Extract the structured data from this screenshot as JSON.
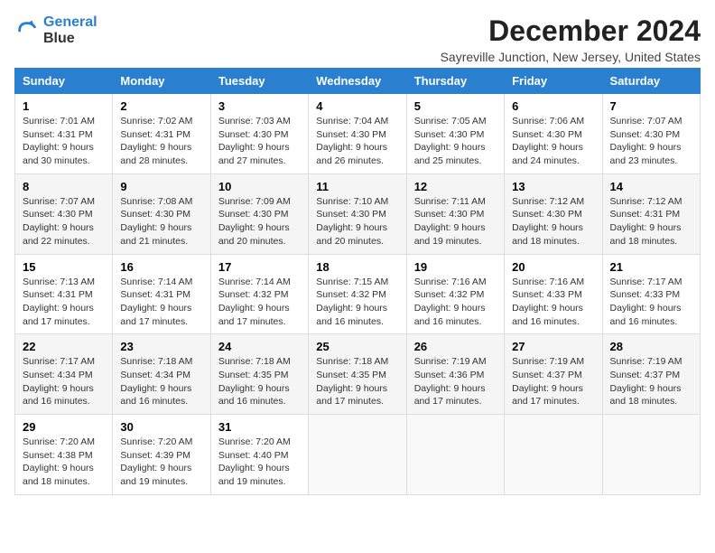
{
  "logo": {
    "name_part1": "General",
    "name_part2": "Blue"
  },
  "title": "December 2024",
  "subtitle": "Sayreville Junction, New Jersey, United States",
  "weekdays": [
    "Sunday",
    "Monday",
    "Tuesday",
    "Wednesday",
    "Thursday",
    "Friday",
    "Saturday"
  ],
  "weeks": [
    [
      {
        "day": "1",
        "info": "Sunrise: 7:01 AM\nSunset: 4:31 PM\nDaylight: 9 hours\nand 30 minutes."
      },
      {
        "day": "2",
        "info": "Sunrise: 7:02 AM\nSunset: 4:31 PM\nDaylight: 9 hours\nand 28 minutes."
      },
      {
        "day": "3",
        "info": "Sunrise: 7:03 AM\nSunset: 4:30 PM\nDaylight: 9 hours\nand 27 minutes."
      },
      {
        "day": "4",
        "info": "Sunrise: 7:04 AM\nSunset: 4:30 PM\nDaylight: 9 hours\nand 26 minutes."
      },
      {
        "day": "5",
        "info": "Sunrise: 7:05 AM\nSunset: 4:30 PM\nDaylight: 9 hours\nand 25 minutes."
      },
      {
        "day": "6",
        "info": "Sunrise: 7:06 AM\nSunset: 4:30 PM\nDaylight: 9 hours\nand 24 minutes."
      },
      {
        "day": "7",
        "info": "Sunrise: 7:07 AM\nSunset: 4:30 PM\nDaylight: 9 hours\nand 23 minutes."
      }
    ],
    [
      {
        "day": "8",
        "info": "Sunrise: 7:07 AM\nSunset: 4:30 PM\nDaylight: 9 hours\nand 22 minutes."
      },
      {
        "day": "9",
        "info": "Sunrise: 7:08 AM\nSunset: 4:30 PM\nDaylight: 9 hours\nand 21 minutes."
      },
      {
        "day": "10",
        "info": "Sunrise: 7:09 AM\nSunset: 4:30 PM\nDaylight: 9 hours\nand 20 minutes."
      },
      {
        "day": "11",
        "info": "Sunrise: 7:10 AM\nSunset: 4:30 PM\nDaylight: 9 hours\nand 20 minutes."
      },
      {
        "day": "12",
        "info": "Sunrise: 7:11 AM\nSunset: 4:30 PM\nDaylight: 9 hours\nand 19 minutes."
      },
      {
        "day": "13",
        "info": "Sunrise: 7:12 AM\nSunset: 4:30 PM\nDaylight: 9 hours\nand 18 minutes."
      },
      {
        "day": "14",
        "info": "Sunrise: 7:12 AM\nSunset: 4:31 PM\nDaylight: 9 hours\nand 18 minutes."
      }
    ],
    [
      {
        "day": "15",
        "info": "Sunrise: 7:13 AM\nSunset: 4:31 PM\nDaylight: 9 hours\nand 17 minutes."
      },
      {
        "day": "16",
        "info": "Sunrise: 7:14 AM\nSunset: 4:31 PM\nDaylight: 9 hours\nand 17 minutes."
      },
      {
        "day": "17",
        "info": "Sunrise: 7:14 AM\nSunset: 4:32 PM\nDaylight: 9 hours\nand 17 minutes."
      },
      {
        "day": "18",
        "info": "Sunrise: 7:15 AM\nSunset: 4:32 PM\nDaylight: 9 hours\nand 16 minutes."
      },
      {
        "day": "19",
        "info": "Sunrise: 7:16 AM\nSunset: 4:32 PM\nDaylight: 9 hours\nand 16 minutes."
      },
      {
        "day": "20",
        "info": "Sunrise: 7:16 AM\nSunset: 4:33 PM\nDaylight: 9 hours\nand 16 minutes."
      },
      {
        "day": "21",
        "info": "Sunrise: 7:17 AM\nSunset: 4:33 PM\nDaylight: 9 hours\nand 16 minutes."
      }
    ],
    [
      {
        "day": "22",
        "info": "Sunrise: 7:17 AM\nSunset: 4:34 PM\nDaylight: 9 hours\nand 16 minutes."
      },
      {
        "day": "23",
        "info": "Sunrise: 7:18 AM\nSunset: 4:34 PM\nDaylight: 9 hours\nand 16 minutes."
      },
      {
        "day": "24",
        "info": "Sunrise: 7:18 AM\nSunset: 4:35 PM\nDaylight: 9 hours\nand 16 minutes."
      },
      {
        "day": "25",
        "info": "Sunrise: 7:18 AM\nSunset: 4:35 PM\nDaylight: 9 hours\nand 17 minutes."
      },
      {
        "day": "26",
        "info": "Sunrise: 7:19 AM\nSunset: 4:36 PM\nDaylight: 9 hours\nand 17 minutes."
      },
      {
        "day": "27",
        "info": "Sunrise: 7:19 AM\nSunset: 4:37 PM\nDaylight: 9 hours\nand 17 minutes."
      },
      {
        "day": "28",
        "info": "Sunrise: 7:19 AM\nSunset: 4:37 PM\nDaylight: 9 hours\nand 18 minutes."
      }
    ],
    [
      {
        "day": "29",
        "info": "Sunrise: 7:20 AM\nSunset: 4:38 PM\nDaylight: 9 hours\nand 18 minutes."
      },
      {
        "day": "30",
        "info": "Sunrise: 7:20 AM\nSunset: 4:39 PM\nDaylight: 9 hours\nand 19 minutes."
      },
      {
        "day": "31",
        "info": "Sunrise: 7:20 AM\nSunset: 4:40 PM\nDaylight: 9 hours\nand 19 minutes."
      },
      null,
      null,
      null,
      null
    ]
  ]
}
